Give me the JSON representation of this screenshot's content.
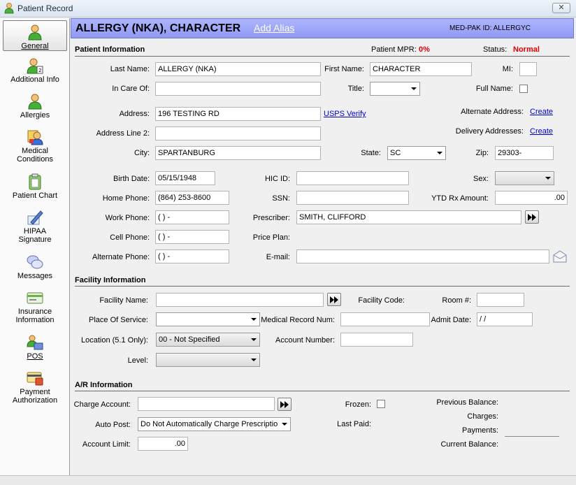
{
  "window": {
    "title": "Patient Record",
    "close_label": "✕"
  },
  "sidebar": {
    "items": [
      {
        "label": "General"
      },
      {
        "label": "Additional Info"
      },
      {
        "label": "Allergies"
      },
      {
        "label": "Medical",
        "label2": "Conditions"
      },
      {
        "label": "Patient Chart"
      },
      {
        "label": "HIPAA",
        "label2": "Signature"
      },
      {
        "label": "Messages"
      },
      {
        "label": "Insurance",
        "label2": "Information"
      },
      {
        "label": "POS"
      },
      {
        "label": "Payment",
        "label2": "Authorization"
      }
    ]
  },
  "header": {
    "patient_name": "ALLERGY (NKA), CHARACTER",
    "add_alias": "Add Alias",
    "medpak_id": "MED-PAK ID: ALLERGYC"
  },
  "patient_info": {
    "section_title": "Patient Information",
    "mpr_label": "Patient MPR:",
    "mpr_value": "0%",
    "status_label": "Status:",
    "status_value": "Normal",
    "last_name_label": "Last Name:",
    "last_name": "ALLERGY (NKA)",
    "first_name_label": "First Name:",
    "first_name": "CHARACTER",
    "mi_label": "MI:",
    "mi": "",
    "care_of_label": "In Care Of:",
    "care_of": "",
    "title_label": "Title:",
    "title": "",
    "full_name_label": "Full Name:",
    "address_label": "Address:",
    "address": "196 TESTING RD",
    "usps_verify": "USPS Verify",
    "alt_address_label": "Alternate Address:",
    "alt_address_link": "Create",
    "address2_label": "Address Line 2:",
    "address2": "",
    "delivery_label": "Delivery Addresses:",
    "delivery_link": "Create",
    "city_label": "City:",
    "city": "SPARTANBURG",
    "state_label": "State:",
    "state": "SC",
    "zip_label": "Zip:",
    "zip": "29303-",
    "birth_label": "Birth Date:",
    "birth": "05/15/1948",
    "hic_label": "HIC ID:",
    "hic": "",
    "sex_label": "Sex:",
    "sex": "",
    "home_phone_label": "Home Phone:",
    "home_phone": "(864) 253-8600",
    "ssn_label": "SSN:",
    "ssn": "",
    "ytd_label": "YTD Rx Amount:",
    "ytd": ".00",
    "work_phone_label": "Work Phone:",
    "work_phone": "(   )    -",
    "prescriber_label": "Prescriber:",
    "prescriber": "SMITH, CLIFFORD",
    "cell_phone_label": "Cell Phone:",
    "cell_phone": "(   )    -",
    "price_plan_label": "Price Plan:",
    "alt_phone_label": "Alternate Phone:",
    "alt_phone": "(   )    -",
    "email_label": "E-mail:",
    "email": ""
  },
  "facility_info": {
    "section_title": "Facility Information",
    "facility_name_label": "Facility Name:",
    "facility_name": "",
    "facility_code_label": "Facility Code:",
    "room_label": "Room #:",
    "room": "",
    "pos_label": "Place Of Service:",
    "pos": "",
    "mrn_label": "Medical Record Num:",
    "mrn": "",
    "admit_label": "Admit Date:",
    "admit": " / /",
    "location_label": "Location (5.1 Only):",
    "location": "00 - Not Specified",
    "account_label": "Account Number:",
    "account": "",
    "level_label": "Level:",
    "level": ""
  },
  "ar_info": {
    "section_title": "A/R Information",
    "charge_label": "Charge Account:",
    "charge": "",
    "frozen_label": "Frozen:",
    "prev_balance_label": "Previous Balance:",
    "charges_label": "Charges:",
    "auto_post_label": "Auto Post:",
    "auto_post": "Do Not Automatically Charge Prescription",
    "last_paid_label": "Last Paid:",
    "payments_label": "Payments:",
    "limit_label": "Account Limit:",
    "limit": ".00",
    "current_balance_label": "Current Balance:"
  }
}
